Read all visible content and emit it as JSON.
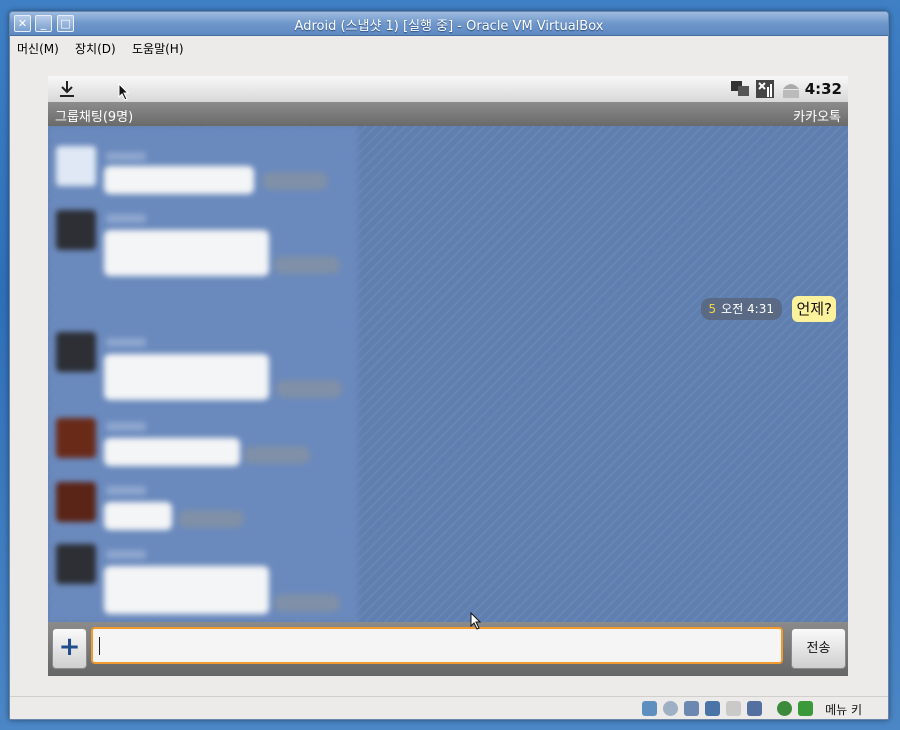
{
  "window": {
    "title": "Adroid (스냅샷 1) [실행 중] - Oracle VM VirtualBox",
    "controls": [
      "close-icon",
      "minimize-icon",
      "maximize-icon"
    ]
  },
  "menubar": {
    "items": [
      {
        "label": "머신(M)"
      },
      {
        "label": "장치(D)"
      },
      {
        "label": "도움말(H)"
      }
    ]
  },
  "android": {
    "statusbar": {
      "time": "4:32",
      "icons": [
        "download-icon",
        "network-icon",
        "signal-icon",
        "android-icon"
      ]
    },
    "chat_header": {
      "title": "그룹채팅(9명)",
      "app_name": "카카오톡"
    },
    "message": {
      "unread_count": "5",
      "time": "오전 4:31",
      "text": "언제?"
    },
    "input": {
      "plus_label": "+",
      "send_label": "전송",
      "value": ""
    }
  },
  "vbox_status": {
    "host_key_label": "메뉴 키",
    "icons": [
      "hard-disk-icon",
      "optical-disk-icon",
      "usb-icon",
      "network-adapter-icon",
      "shared-folder-icon",
      "capture-icon",
      "mouse-integration-icon",
      "keyboard-capture-icon"
    ]
  },
  "colors": {
    "titlebar": "#6f97cb",
    "chat_background": "#5f7fb0",
    "my_bubble": "#fdf29c",
    "input_border": "#f19a2e"
  }
}
